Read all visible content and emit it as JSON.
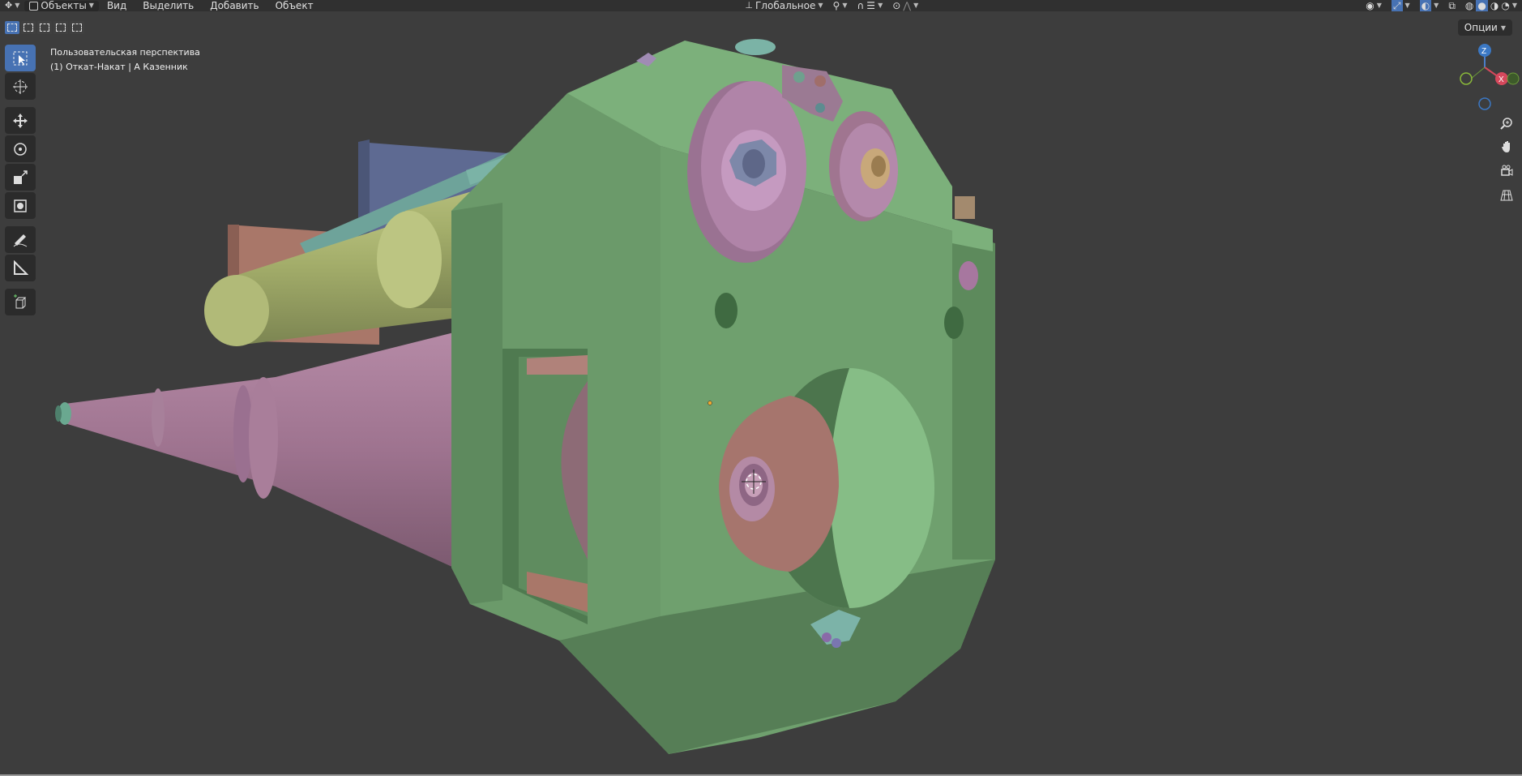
{
  "header": {
    "mode_label": "Объекты",
    "menus": [
      "Вид",
      "Выделить",
      "Добавить",
      "Объект"
    ],
    "transform_orientation": "Глобальное"
  },
  "options_label": "Опции",
  "viewport": {
    "view_name": "Пользовательская перспектива",
    "object_info": "(1) Откат-Накат | А Казенник"
  },
  "gizmo": {
    "z": "Z",
    "x": "X"
  },
  "tools": [
    "select-box",
    "cursor",
    "move",
    "rotate",
    "scale",
    "transform",
    "annotate",
    "measure",
    "add-cube"
  ],
  "colors": {
    "accent": "#4772b3",
    "viewport_bg": "#3d3d3d",
    "breech_green": "#6fa06e",
    "barrel_pink": "#a47b96",
    "cylinder_olive": "#a3ad6a",
    "plate_blue": "#5e6a92",
    "plate_salmon": "#a97769"
  }
}
